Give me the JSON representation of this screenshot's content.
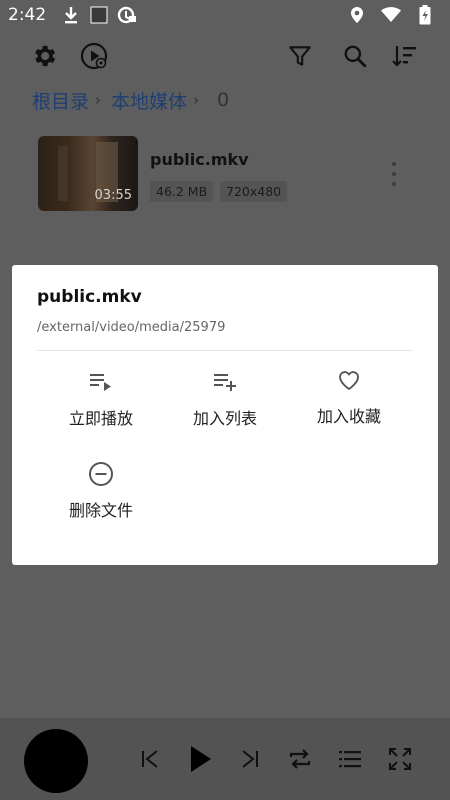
{
  "status_bar": {
    "time": "2:42",
    "icons": [
      "download-icon",
      "square-notification-icon",
      "app-notification-icon",
      "location-icon",
      "wifi-icon",
      "battery-charging-icon"
    ]
  },
  "toolbar": {
    "left_icons": [
      "gear-icon",
      "play-circle-settings-icon"
    ],
    "right_icons": [
      "filter-icon",
      "search-icon",
      "sort-icon"
    ]
  },
  "breadcrumb": {
    "items": [
      "根目录",
      "本地媒体"
    ],
    "separator": "›",
    "count": "0"
  },
  "media_item": {
    "title": "public.mkv",
    "duration": "03:55",
    "size": "46.2 MB",
    "resolution": "720x480"
  },
  "dialog": {
    "title": "public.mkv",
    "path": "/external/video/media/25979",
    "actions": [
      {
        "label": "立即播放",
        "icon": "play-next-icon"
      },
      {
        "label": "加入列表",
        "icon": "playlist-add-icon"
      },
      {
        "label": "加入收藏",
        "icon": "heart-outline-icon"
      },
      {
        "label": "删除文件",
        "icon": "remove-circle-icon"
      }
    ]
  },
  "player": {
    "controls": [
      "skip-previous-icon",
      "play-icon",
      "skip-next-icon",
      "repeat-icon",
      "playlist-icon",
      "fullscreen-icon"
    ]
  }
}
